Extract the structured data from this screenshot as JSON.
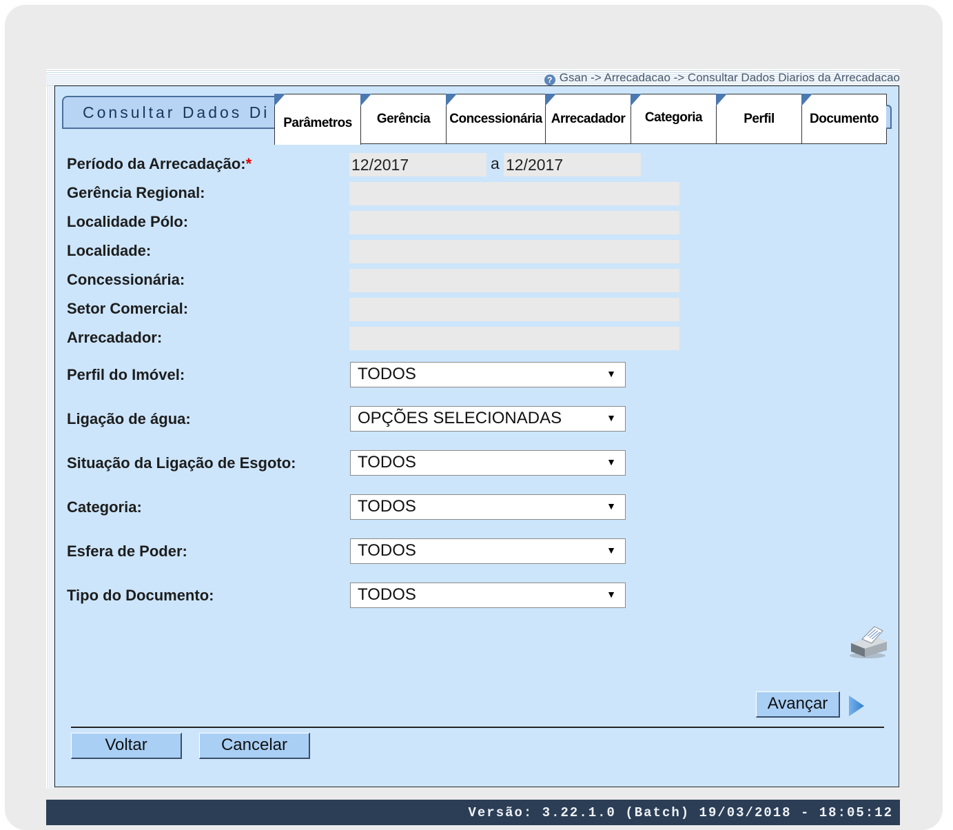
{
  "breadcrumb": "Gsan -> Arrecadacao -> Consultar Dados Diarios da Arrecadacao",
  "title_tab": "Consultar Dados Di",
  "tabs": [
    {
      "label": "Parâmetros"
    },
    {
      "label": "Gerência"
    },
    {
      "label": "Concessionária"
    },
    {
      "label": "Arrecadador"
    },
    {
      "label": "Categoria"
    },
    {
      "label": "Perfil"
    },
    {
      "label": "Documento"
    }
  ],
  "form": {
    "periodo_label": "Período da Arrecadação:",
    "required_mark": "*",
    "periodo_inicio": "12/2017",
    "periodo_sep": "a",
    "periodo_fim": "12/2017",
    "gerencia_label": "Gerência Regional:",
    "localidade_polo_label": "Localidade Pólo:",
    "localidade_label": "Localidade:",
    "concessionaria_label": "Concessionária:",
    "setor_label": "Setor Comercial:",
    "arrecadador_label": "Arrecadador:",
    "perfil_label": "Perfil do Imóvel:",
    "perfil_value": "TODOS",
    "ligacao_agua_label": "Ligação de água:",
    "ligacao_agua_value": "OPÇÕES SELECIONADAS",
    "esgoto_label": "Situação da Ligação de Esgoto:",
    "esgoto_value": "TODOS",
    "categoria_label": "Categoria:",
    "categoria_value": "TODOS",
    "esfera_label": "Esfera de Poder:",
    "esfera_value": "TODOS",
    "tipo_doc_label": "Tipo do Documento:",
    "tipo_doc_value": "TODOS"
  },
  "buttons": {
    "avancar": "Avançar",
    "voltar": "Voltar",
    "cancelar": "Cancelar"
  },
  "footer": "Versão: 3.22.1.0 (Batch) 19/03/2018 - 18:05:12",
  "icons": {
    "help": "help-icon",
    "printer": "printer-icon",
    "next": "arrow-right-icon",
    "dropdown": "chevron-down-icon"
  },
  "colors": {
    "panel_bg": "#cce5fb",
    "footer_bg": "#2c3e55",
    "button_bg": "#a9cff5",
    "tab_accent": "#4a78b0",
    "required": "#dd0000"
  }
}
